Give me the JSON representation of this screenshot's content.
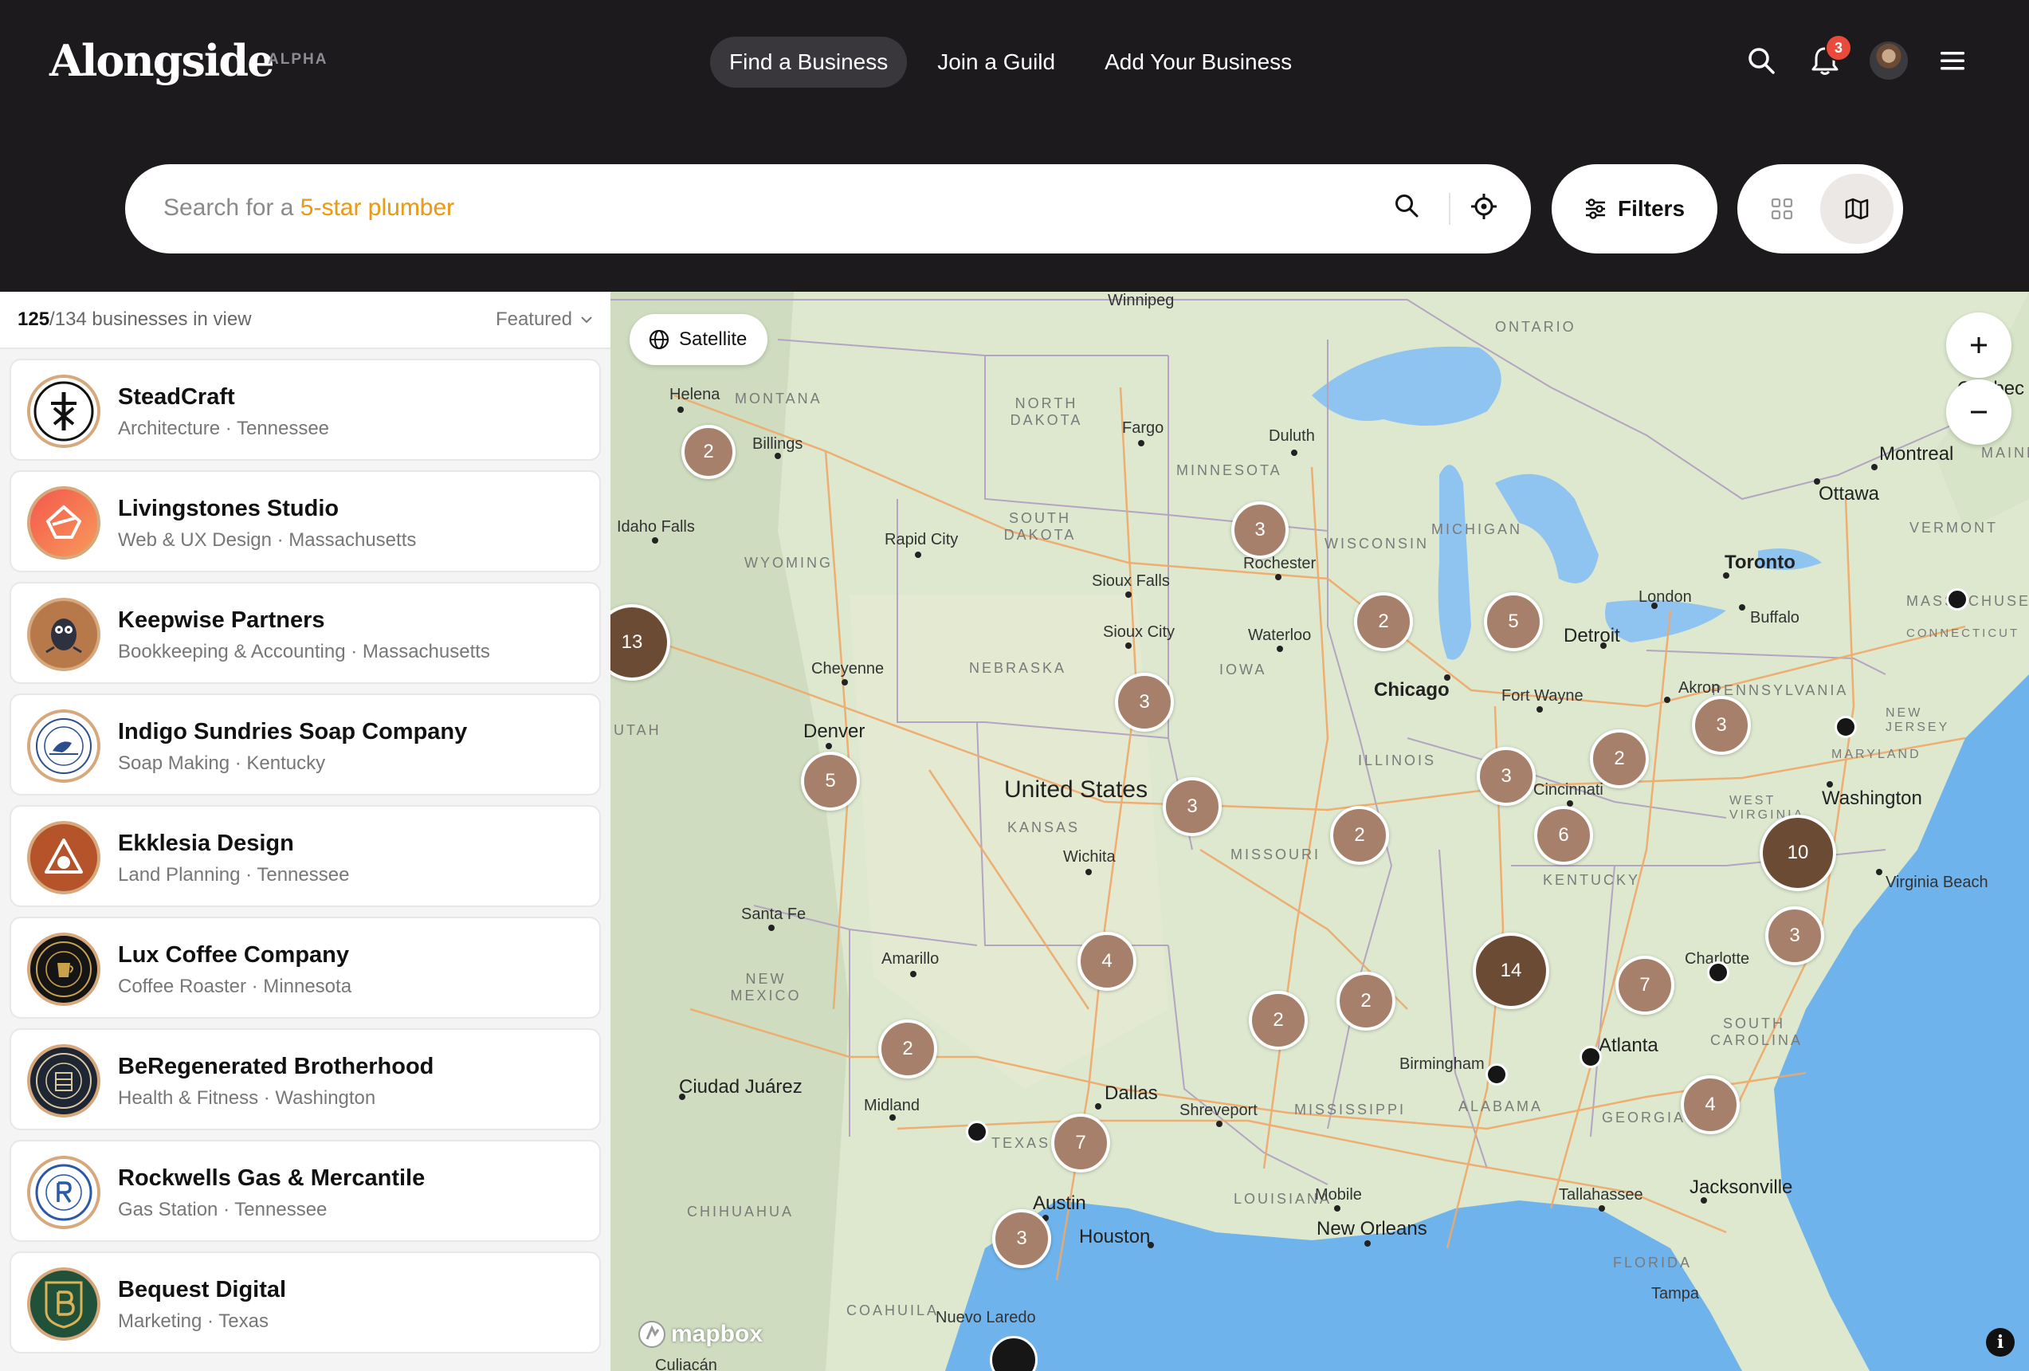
{
  "header": {
    "logo_text": "Alongside",
    "badge": "ALPHA",
    "nav": [
      "Find a Business",
      "Join a Guild",
      "Add Your Business"
    ],
    "notification_count": "3"
  },
  "search": {
    "placeholder_prefix": "Search for a ",
    "placeholder_highlight": "5-star plumber",
    "filters_label": "Filters"
  },
  "list": {
    "count_in_view": "125",
    "count_total": "/134 businesses in view",
    "sort_label": "Featured",
    "businesses": [
      {
        "name": "SteadCraft",
        "meta": "Architecture · Tennessee"
      },
      {
        "name": "Livingstones Studio",
        "meta": "Web & UX Design · Massachusetts"
      },
      {
        "name": "Keepwise Partners",
        "meta": "Bookkeeping & Accounting · Massachusetts"
      },
      {
        "name": "Indigo Sundries Soap Company",
        "meta": "Soap Making · Kentucky"
      },
      {
        "name": "Ekklesia Design",
        "meta": "Land Planning · Tennessee"
      },
      {
        "name": "Lux Coffee Company",
        "meta": "Coffee Roaster · Minnesota"
      },
      {
        "name": "BeRegenerated Brotherhood",
        "meta": "Health & Fitness · Washington"
      },
      {
        "name": "Rockwells Gas & Mercantile",
        "meta": "Gas Station · Tennessee"
      },
      {
        "name": "Bequest Digital",
        "meta": "Marketing · Texas"
      }
    ]
  },
  "map": {
    "satellite_label": "Satellite",
    "attribution": "mapbox",
    "country_label": "United States",
    "clusters": [
      "2",
      "3",
      "13",
      "2",
      "5",
      "3",
      "5",
      "3",
      "3",
      "2",
      "3",
      "2",
      "6",
      "10",
      "3",
      "4",
      "2",
      "2",
      "14",
      "7",
      "2",
      "7",
      "4",
      "3"
    ],
    "cities": [
      "Winnipeg",
      "Helena",
      "Billings",
      "Idaho Falls",
      "Fargo",
      "Duluth",
      "Rapid City",
      "Sioux Falls",
      "Sioux City",
      "Rochester",
      "Waterloo",
      "Cheyenne",
      "Denver",
      "Chicago",
      "Detroit",
      "Fort Wayne",
      "Toronto",
      "London",
      "Buffalo",
      "Akron",
      "Ottawa",
      "Montreal",
      "Quebec",
      "Cincinnati",
      "Washington",
      "Virginia Beach",
      "Wichita",
      "Santa Fe",
      "Amarillo",
      "Charlotte",
      "Atlanta",
      "Birmingham",
      "Shreveport",
      "Dallas",
      "Midland",
      "Ciudad Juárez",
      "Austin",
      "Houston",
      "Mobile",
      "New Orleans",
      "Tallahassee",
      "Jacksonville",
      "Tampa",
      "Nuevo Laredo",
      "Culiacán"
    ],
    "states": [
      "MONTANA",
      "NORTH DAKOTA",
      "MINNESOTA",
      "SOUTH DAKOTA",
      "WYOMING",
      "NEBRASKA",
      "IOWA",
      "WISCONSIN",
      "MICHIGAN",
      "ONTARIO",
      "MAINE",
      "VERMONT",
      "MASSACHUSETTS",
      "CONNECTICUT",
      "PENNSYLVANIA",
      "NEW JERSEY",
      "MARYLAND",
      "WEST VIRGINIA",
      "ILLINOIS",
      "KANSAS",
      "MISSOURI",
      "KENTUCKY",
      "NEW MEXICO",
      "TEXAS",
      "MISSISSIPPI",
      "ALABAMA",
      "GEORGIA",
      "SOUTH CAROLINA",
      "LOUISIANA",
      "FLORIDA",
      "CHIHUAHUA",
      "COAHUILA",
      "UTAH"
    ]
  }
}
